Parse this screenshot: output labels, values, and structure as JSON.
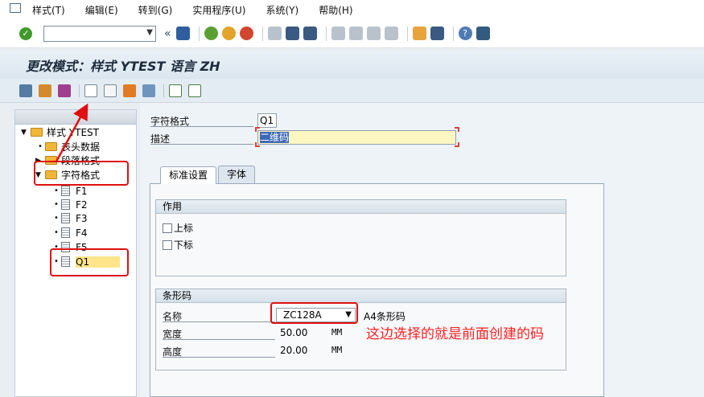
{
  "menubar": {
    "items": [
      "样式(T)",
      "编辑(E)",
      "转到(G)",
      "实用程序(U)",
      "系统(Y)",
      "帮助(H)"
    ]
  },
  "stdbar": {
    "back_glyph": "«",
    "command_value": ""
  },
  "title": "更改模式：样式 YTEST 语言 ZH",
  "tree": {
    "root": "样式 YTEST",
    "items": [
      "表头数据",
      "段落格式",
      "字符格式"
    ],
    "children": [
      "F1",
      "F2",
      "F3",
      "F4",
      "F5",
      "Q1"
    ]
  },
  "form": {
    "char_format_label": "字符格式",
    "char_format_value": "Q1",
    "desc_label": "描述",
    "desc_value": "二维码"
  },
  "tabs": [
    "标准设置",
    "字体"
  ],
  "group_effect": {
    "title": "作用",
    "checkbox_super": "上标",
    "checkbox_sub": "下标"
  },
  "group_barcode": {
    "title": "条形码",
    "name_label": "名称",
    "name_value": "ZC128A",
    "name_desc": "A4条形码",
    "width_label": "宽度",
    "width_value": "50.00",
    "width_unit": "MM",
    "height_label": "高度",
    "height_value": "20.00",
    "height_unit": "MM"
  },
  "annotation": {
    "note": "这边选择的就是前面创建的码",
    "color": "#e01010"
  }
}
